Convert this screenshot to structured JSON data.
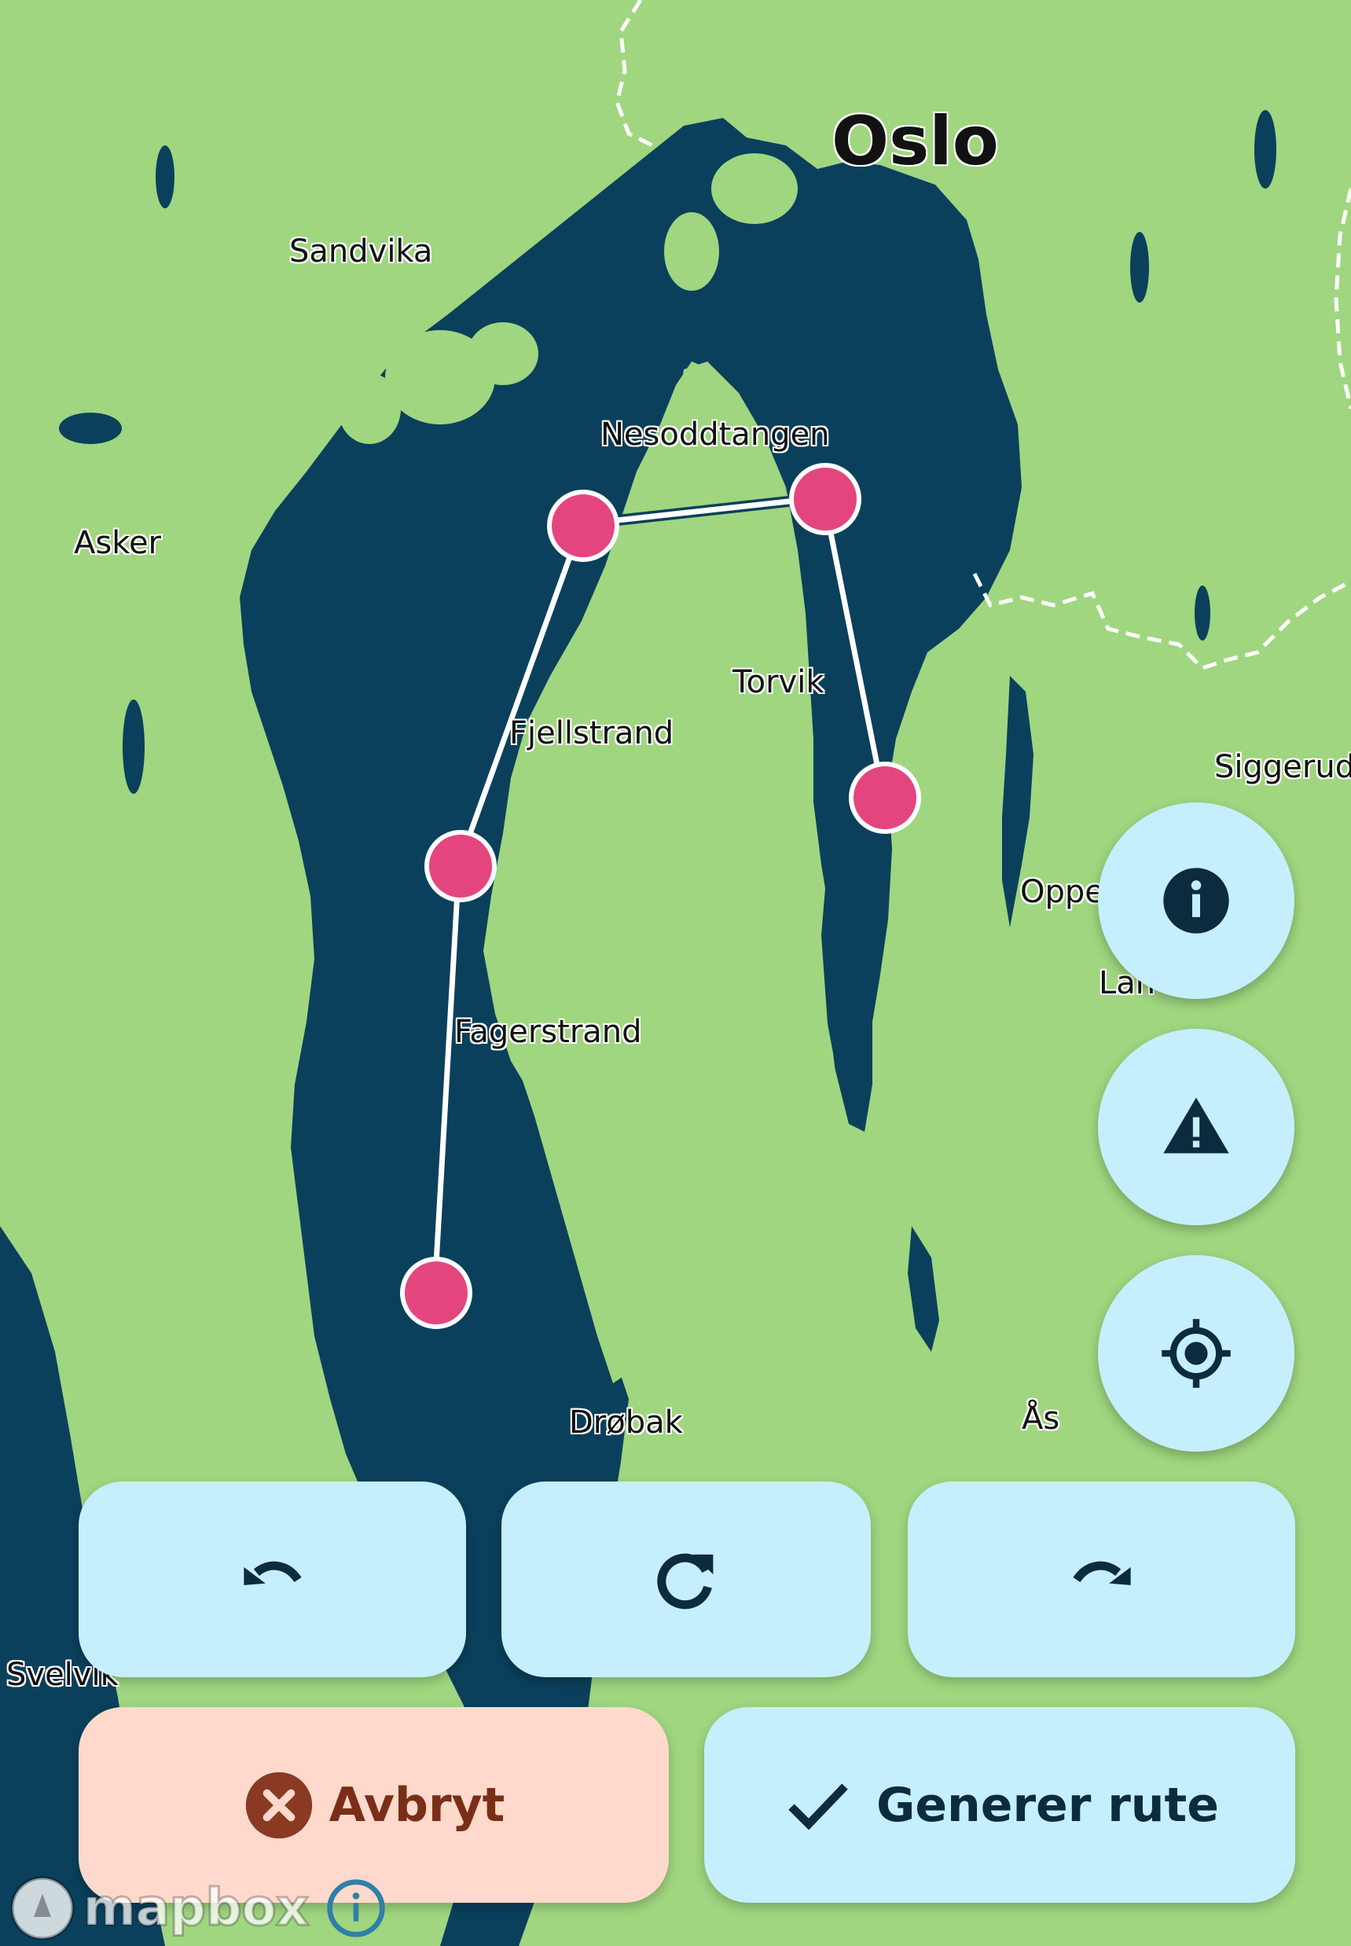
{
  "map": {
    "colors": {
      "land": "#9fd67f",
      "water": "#0a405c",
      "marker": "#e5457f",
      "route": "#ffffff",
      "border": "#ffffff"
    },
    "places": [
      {
        "name": "Oslo"
      },
      {
        "name": "Sandvika"
      },
      {
        "name": "Nesoddtangen"
      },
      {
        "name": "Asker"
      },
      {
        "name": "Torvik"
      },
      {
        "name": "Fjellstrand"
      },
      {
        "name": "Siggerud"
      },
      {
        "name": "Oppe"
      },
      {
        "name": "Lan"
      },
      {
        "name": "Fagerstrand"
      },
      {
        "name": "Drøbak"
      },
      {
        "name": "Ås"
      },
      {
        "name": "Svelvik"
      }
    ],
    "route_point_count": 5
  },
  "fab": {
    "info_icon": "info-icon",
    "warning_icon": "warning-icon",
    "location_icon": "my-location-icon"
  },
  "toolbar": {
    "undo_icon": "undo-icon",
    "reset_icon": "refresh-icon",
    "redo_icon": "redo-icon"
  },
  "actions": {
    "cancel_label": "Avbryt",
    "cancel_icon": "cancel-circle-icon",
    "generate_label": "Generer rute",
    "generate_icon": "checkmark-icon"
  },
  "attribution": {
    "logo_text": "mapbox",
    "info_icon": "attribution-info-icon"
  }
}
